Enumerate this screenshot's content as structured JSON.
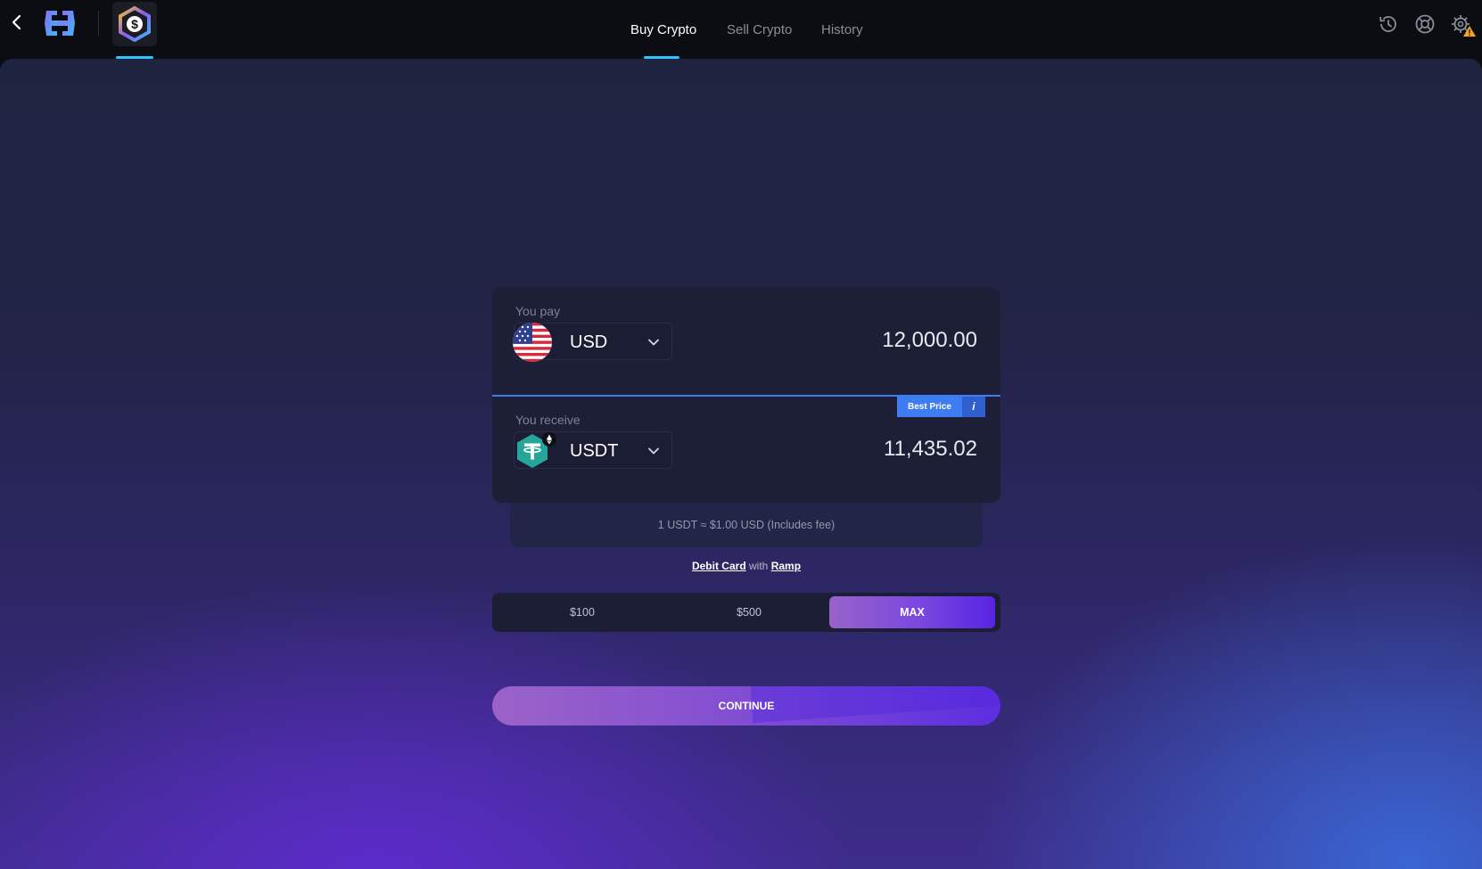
{
  "header": {
    "tabs": [
      {
        "label": "Buy Crypto",
        "active": true
      },
      {
        "label": "Sell Crypto",
        "active": false
      },
      {
        "label": "History",
        "active": false
      }
    ],
    "icons": [
      "back-icon",
      "exodus-logo-icon",
      "buy-crypto-app-icon",
      "history-icon",
      "support-icon",
      "settings-warning-icon"
    ]
  },
  "pay": {
    "label": "You pay",
    "currency": "USD",
    "amount": "12,000.00"
  },
  "receive": {
    "label": "You receive",
    "currency": "USDT",
    "amount": "11,435.02",
    "badge": "Best Price",
    "badge_info": "i"
  },
  "rate": "1 USDT ≈ $1.00 USD (Includes fee)",
  "provider": {
    "method": "Debit Card",
    "connector": "with",
    "name": "Ramp"
  },
  "presets": [
    "$100",
    "$500",
    "MAX"
  ],
  "continue_label": "CONTINUE",
  "colors": {
    "accent_blue": "#3d7cf2",
    "tab_underline": "#2ec4ff",
    "button_purple": "#7a47e0"
  }
}
